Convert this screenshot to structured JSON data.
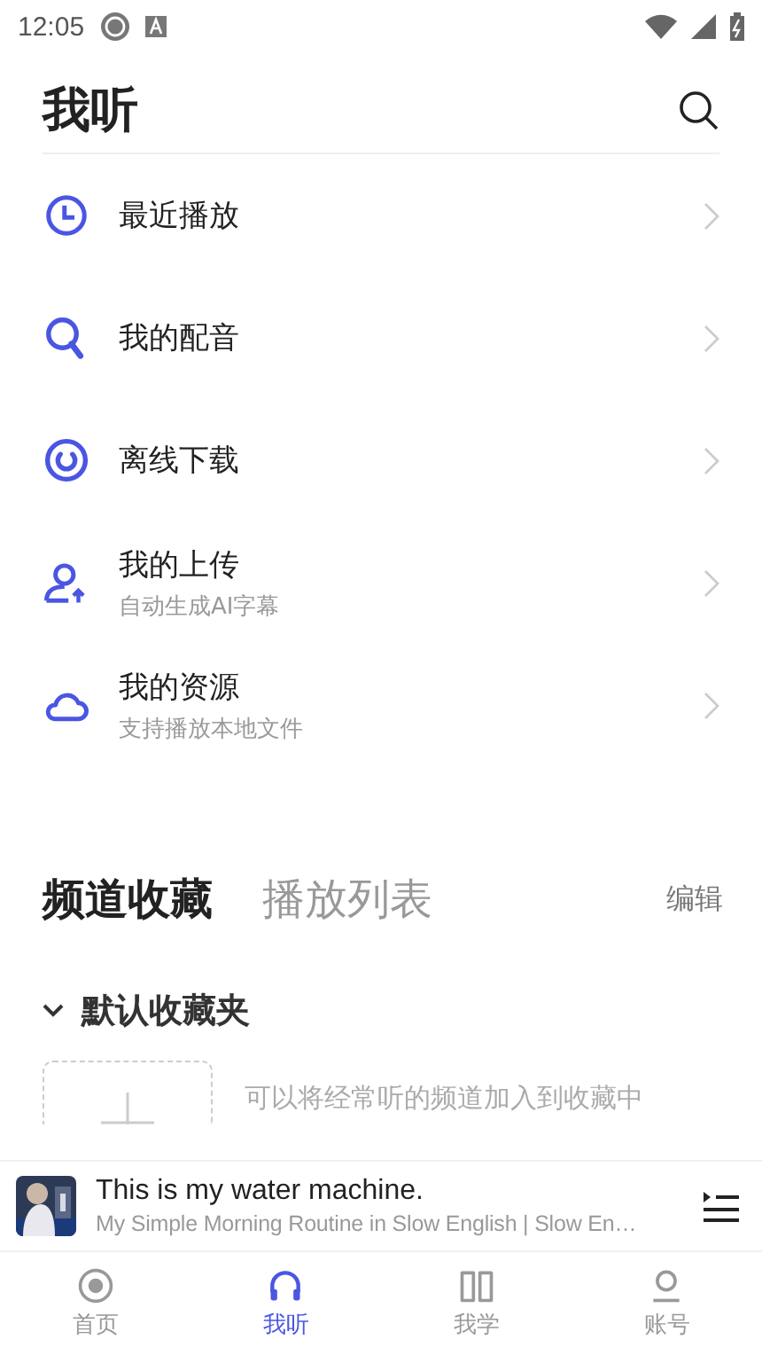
{
  "status_bar": {
    "time": "12:05"
  },
  "header": {
    "title": "我听"
  },
  "menu": [
    {
      "kind": "clock",
      "title": "最近播放"
    },
    {
      "kind": "search",
      "title": "我的配音"
    },
    {
      "kind": "download",
      "title": "离线下载"
    },
    {
      "kind": "upload",
      "title": "我的上传",
      "subtitle": "自动生成AI字幕"
    },
    {
      "kind": "cloud",
      "title": "我的资源",
      "subtitle": "支持播放本地文件"
    }
  ],
  "tabs": [
    {
      "label": "频道收藏",
      "selected": true
    },
    {
      "label": "播放列表",
      "selected": false
    }
  ],
  "edit": "编辑",
  "folder": {
    "name": "默认收藏夹",
    "expanded": true,
    "hint": "可以将经常听的频道加入到收藏中"
  },
  "player": {
    "title": "This is my water machine.",
    "subtitle": "My Simple Morning Routine in Slow English | Slow En…"
  },
  "nav": [
    {
      "kind": "home",
      "label": "首页",
      "selected": false
    },
    {
      "kind": "listen",
      "label": "我听",
      "selected": true
    },
    {
      "kind": "learn",
      "label": "我学",
      "selected": false
    },
    {
      "kind": "account",
      "label": "账号",
      "selected": false
    }
  ]
}
